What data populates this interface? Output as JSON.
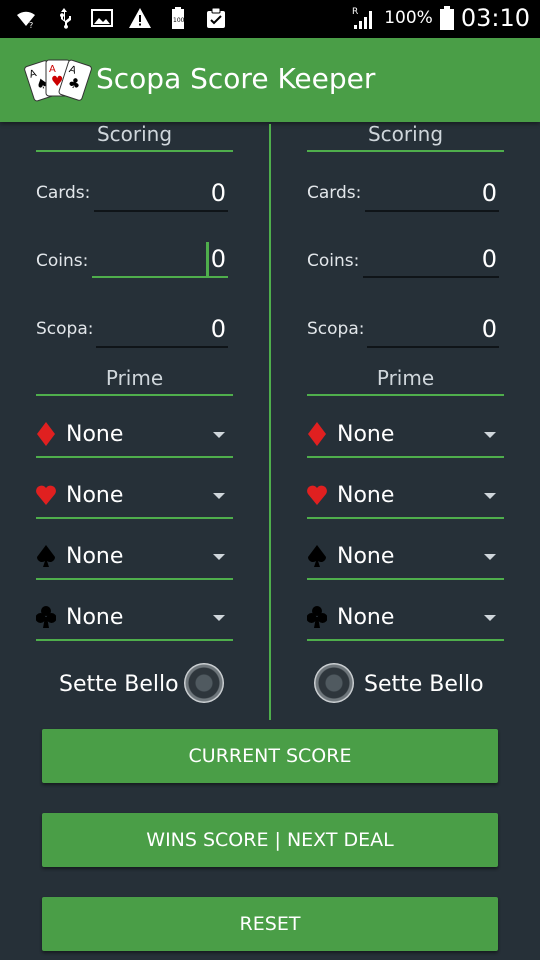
{
  "status_bar": {
    "battery_percent": "100%",
    "time": "03:10",
    "icons": [
      "wifi-icon",
      "usb-icon",
      "image-icon",
      "warning-icon",
      "battery-100-icon",
      "clipboard-check-icon",
      "signal-icon",
      "battery-icon"
    ],
    "battery_label": "100"
  },
  "app": {
    "title": "Scopa Score Keeper",
    "accent": "#4a9e47",
    "background": "#263038"
  },
  "players": [
    {
      "scoring_header": "Scoring",
      "cards_label": "Cards:",
      "cards_value": "0",
      "coins_label": "Coins:",
      "coins_value": "0",
      "scopa_label": "Scopa:",
      "scopa_value": "0",
      "prime_header": "Prime",
      "diamonds": "None",
      "hearts": "None",
      "spades": "None",
      "clubs": "None",
      "sette_bello": "Sette Bello"
    },
    {
      "scoring_header": "Scoring",
      "cards_label": "Cards:",
      "cards_value": "0",
      "coins_label": "Coins:",
      "coins_value": "0",
      "scopa_label": "Scopa:",
      "scopa_value": "0",
      "prime_header": "Prime",
      "diamonds": "None",
      "hearts": "None",
      "spades": "None",
      "clubs": "None",
      "sette_bello": "Sette Bello"
    }
  ],
  "buttons": {
    "current_score": "CURRENT SCORE",
    "wins_score": "WINS SCORE | NEXT DEAL",
    "reset": "RESET"
  }
}
